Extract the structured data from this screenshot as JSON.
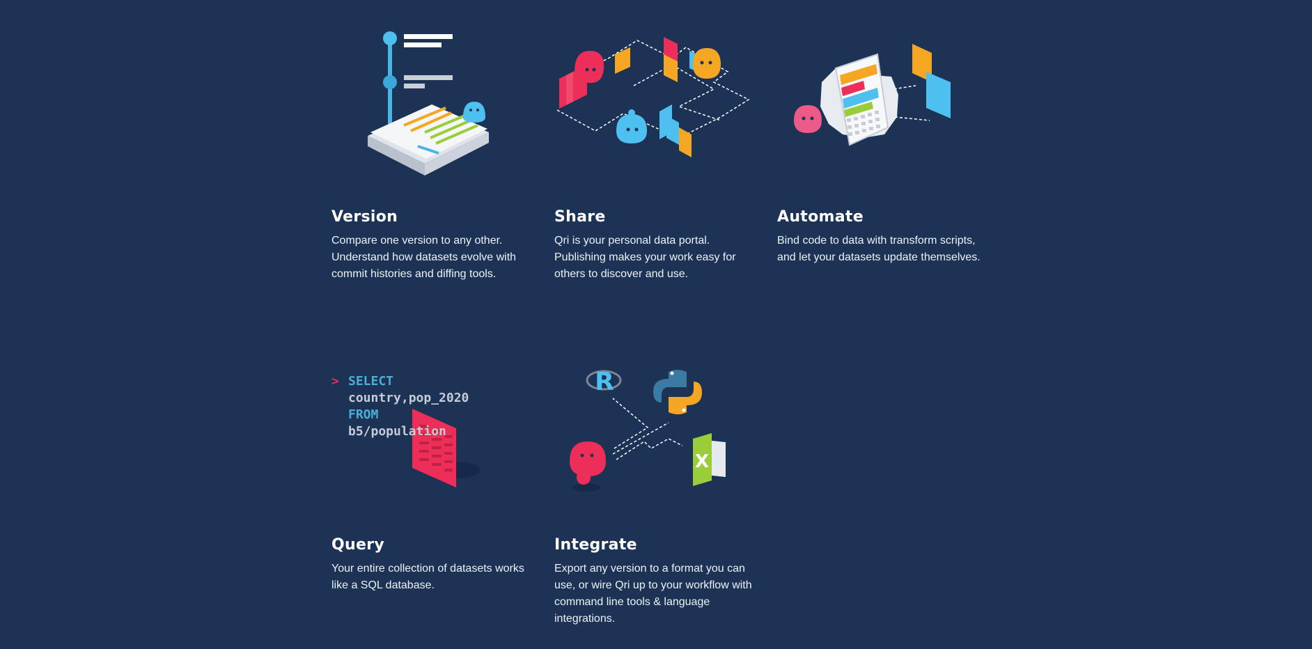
{
  "features": [
    {
      "title": "Version",
      "desc": "Compare one version to any other. Understand how datasets evolve with commit histories and diffing tools."
    },
    {
      "title": "Share",
      "desc": "Qri is your personal data portal. Publishing makes your work easy for others to discover and use."
    },
    {
      "title": "Automate",
      "desc": "Bind code to data with transform scripts, and let your datasets update themselves."
    },
    {
      "title": "Query",
      "desc": "Your entire collection of datasets works like a SQL database."
    },
    {
      "title": "Integrate",
      "desc": "Export any version to a format you can use, or wire Qri up to your workflow with command line tools & language integrations."
    }
  ],
  "query_code": {
    "prompt": ">",
    "line1": "SELECT",
    "line2": "country,pop_2020",
    "line3": "FROM",
    "line4": "b5/population"
  },
  "integrate_icons": {
    "r": "R",
    "excel": "X"
  },
  "colors": {
    "background": "#1d3356",
    "blue": "#4ec0f0",
    "pink": "#ec2e58",
    "orange": "#f5a623",
    "green": "#9acd3a"
  }
}
